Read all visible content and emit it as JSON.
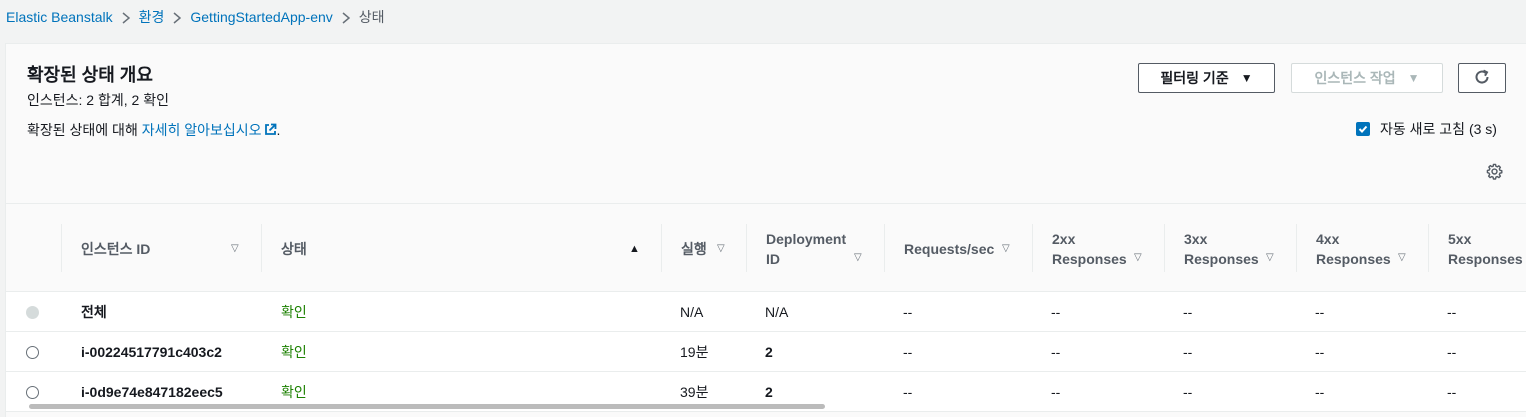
{
  "breadcrumb": [
    "Elastic Beanstalk",
    "환경",
    "GettingStartedApp-env",
    "상태"
  ],
  "header": {
    "title": "확장된 상태 개요",
    "subtitle": "인스턴스: 2 합계, 2 확인",
    "desc_prefix": "확장된 상태에 대해 ",
    "desc_link": "자세히 알아보십시오",
    "desc_suffix": "."
  },
  "buttons": {
    "filter": "필터링 기준",
    "actions": "인스턴스 작업"
  },
  "auto_refresh": {
    "label": "자동 새로 고침 (3 s)",
    "checked": true
  },
  "columns": {
    "instance_id": "인스턴스 ID",
    "status": "상태",
    "running": "실행",
    "deployment_1": "Deployment",
    "deployment_2": "ID",
    "requests": "Requests/sec",
    "r2xx_1": "2xx",
    "r2xx_2": "Responses",
    "r3xx_1": "3xx",
    "r3xx_2": "Responses",
    "r4xx_1": "4xx",
    "r4xx_2": "Responses",
    "r5xx_1": "5xx",
    "r5xx_2": "Responses"
  },
  "rows": [
    {
      "id": "전체",
      "status": "확인",
      "running": "N/A",
      "deployment": "N/A",
      "requests": "--",
      "r2xx": "--",
      "r3xx": "--",
      "r4xx": "--",
      "r5xx": "--"
    },
    {
      "id": "i-00224517791c403c2",
      "status": "확인",
      "running": "19분",
      "deployment": "2",
      "requests": "--",
      "r2xx": "--",
      "r3xx": "--",
      "r4xx": "--",
      "r5xx": "--"
    },
    {
      "id": "i-0d9e74e847182eec5",
      "status": "확인",
      "running": "39분",
      "deployment": "2",
      "requests": "--",
      "r2xx": "--",
      "r3xx": "--",
      "r4xx": "--",
      "r5xx": "--"
    }
  ],
  "colors": {
    "link": "#0073bb",
    "ok": "#1d8102"
  }
}
